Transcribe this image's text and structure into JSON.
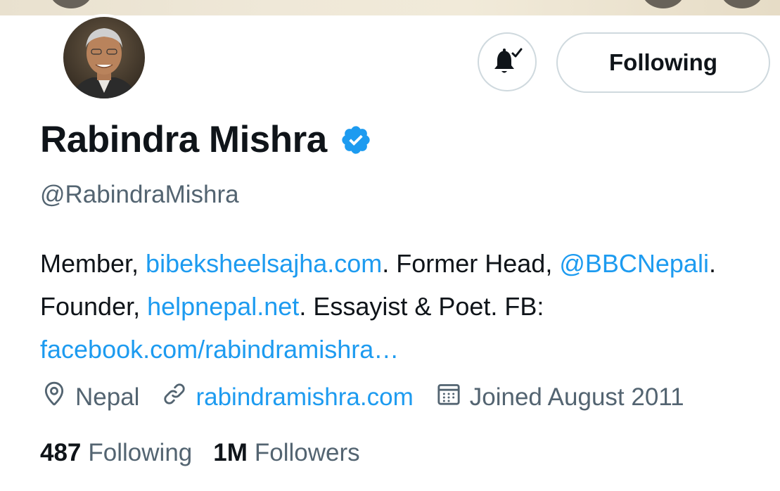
{
  "profile": {
    "name": "Rabindra Mishra",
    "handle": "@RabindraMishra",
    "follow_button_label": "Following"
  },
  "bio": {
    "t1": "Member, ",
    "link1": "bibeksheelsajha.com",
    "t2": ". Former Head, ",
    "link2": "@BBCNepali",
    "t3": ". Founder, ",
    "link3": "helpnepal.net",
    "t4": ". Essayist & Poet. FB: ",
    "link4": "facebook.com/rabindramishra…"
  },
  "meta": {
    "location": "Nepal",
    "website": "rabindramishra.com",
    "joined": "Joined August 2011"
  },
  "stats": {
    "following_count": "487",
    "following_label": "Following",
    "followers_count": "1M",
    "followers_label": "Followers"
  },
  "icons": {
    "location": "location-pin-icon",
    "link": "link-icon",
    "calendar": "calendar-icon",
    "bell": "bell-subscribed-icon",
    "verified": "verified-badge-icon"
  },
  "colors": {
    "accent": "#1d9bf0",
    "text_primary": "#0f1419",
    "text_secondary": "#536471",
    "border": "#cfd9de"
  }
}
